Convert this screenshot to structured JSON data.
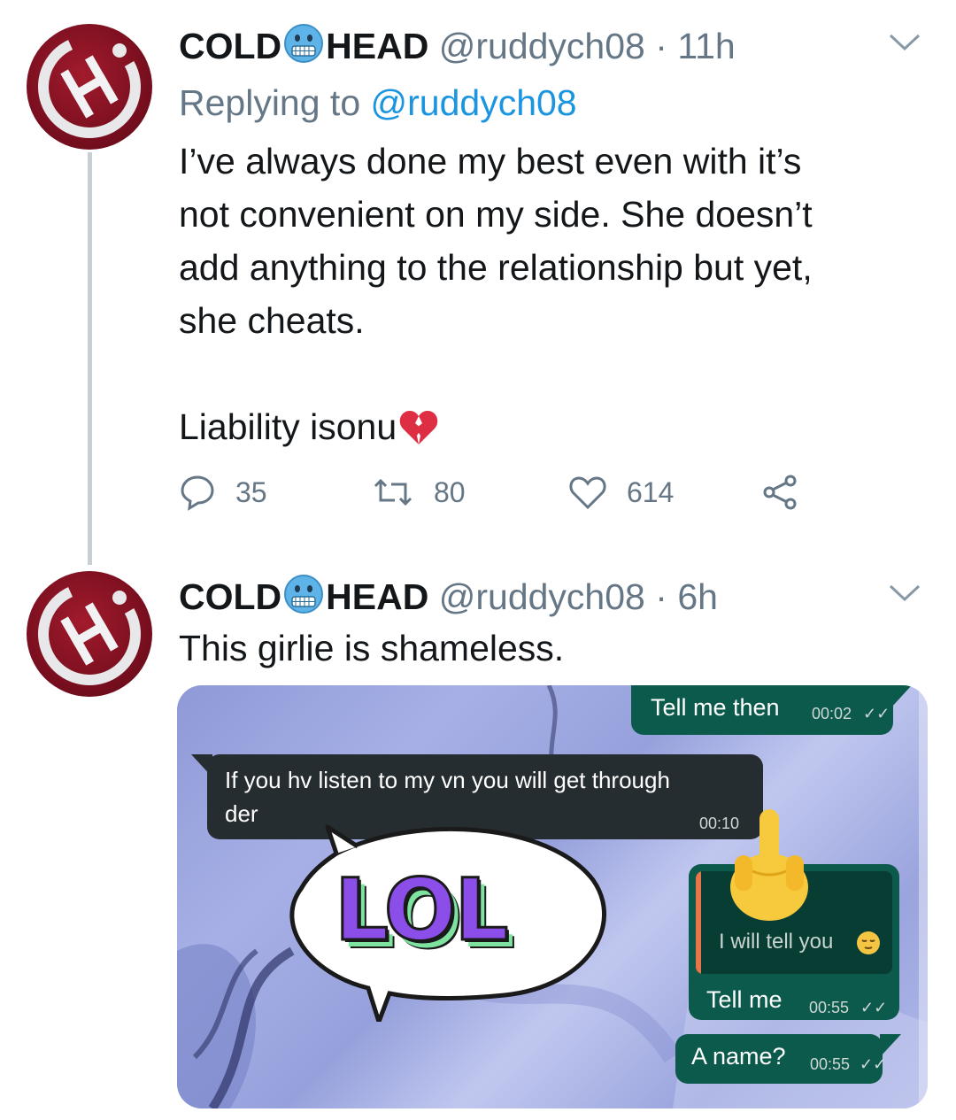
{
  "tweets": [
    {
      "name_part1": "COLD",
      "name_part2": "HEAD",
      "handle": "@ruddych08",
      "dot": "·",
      "time": "11h",
      "replying_prefix": "Replying to ",
      "replying_handle": "@ruddych08",
      "body_lines": [
        "I’ve always done my best even with it’s",
        "not convenient on my side. She doesn’t",
        "add anything to the relationship but yet,",
        "she cheats."
      ],
      "body_last": "Liability isonu",
      "replies": "35",
      "retweets": "80",
      "likes": "614"
    },
    {
      "name_part1": "COLD",
      "name_part2": "HEAD",
      "handle": "@ruddych08",
      "dot": "·",
      "time": "6h",
      "body": "This girlie is shameless."
    }
  ],
  "chat": {
    "msg1_text": "Tell me then",
    "msg1_time": "00:02",
    "msg2_text_line1": "If you hv listen to my vn you will get through",
    "msg2_text_line2": "der",
    "msg2_time": "00:10",
    "sticker_text": "LOL",
    "quote_text": "I will tell you",
    "msg3_text": "Tell me",
    "msg3_time": "00:55",
    "msg4_text": "A name?",
    "msg4_time": "00:55",
    "ticks": "✓✓"
  },
  "colors": {
    "text": "#14171a",
    "secondary": "#657786",
    "link": "#1b95e0",
    "outgoing_bubble": "#0c5a4c",
    "incoming_bubble": "#262d31",
    "sticker_purple": "#8b4ee8",
    "sticker_green": "#7fe3a0"
  }
}
